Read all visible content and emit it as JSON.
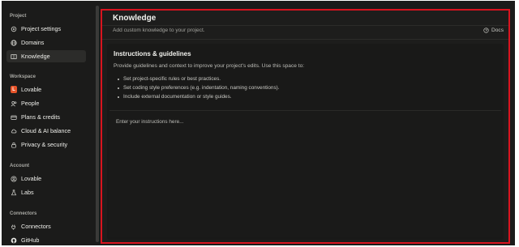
{
  "sidebar": {
    "sections": [
      {
        "title": "Project",
        "items": [
          {
            "label": "Project settings",
            "icon": "gear-icon"
          },
          {
            "label": "Domains",
            "icon": "globe-icon"
          },
          {
            "label": "Knowledge",
            "icon": "book-icon",
            "active": true
          }
        ]
      },
      {
        "title": "Workspace",
        "items": [
          {
            "label": "Lovable",
            "icon": "lovable-logo",
            "badge": "L"
          },
          {
            "label": "People",
            "icon": "people-icon"
          },
          {
            "label": "Plans & credits",
            "icon": "credit-card-icon"
          },
          {
            "label": "Cloud & AI balance",
            "icon": "cloud-icon"
          },
          {
            "label": "Privacy & security",
            "icon": "lock-icon"
          }
        ]
      },
      {
        "title": "Account",
        "items": [
          {
            "label": "Lovable",
            "icon": "user-circle-icon"
          },
          {
            "label": "Labs",
            "icon": "flask-icon"
          }
        ]
      },
      {
        "title": "Connectors",
        "items": [
          {
            "label": "Connectors",
            "icon": "plug-icon"
          },
          {
            "label": "GitHub",
            "icon": "github-icon"
          }
        ]
      }
    ]
  },
  "main": {
    "title": "Knowledge",
    "subtitle": "Add custom knowledge to your project.",
    "docs_label": "Docs",
    "card": {
      "title": "Instructions & guidelines",
      "description": "Provide guidelines and context to improve your project's edits. Use this space to:",
      "bullets": [
        "Set project-specific rules or best practices.",
        "Set coding style preferences (e.g. indentation, naming conventions).",
        "Include external documentation or style guides."
      ],
      "placeholder": "Enter your instructions here..."
    }
  },
  "colors": {
    "background": "#1b1b1a",
    "highlight_border": "#d9141f",
    "lovable_badge": "#e6542a"
  }
}
